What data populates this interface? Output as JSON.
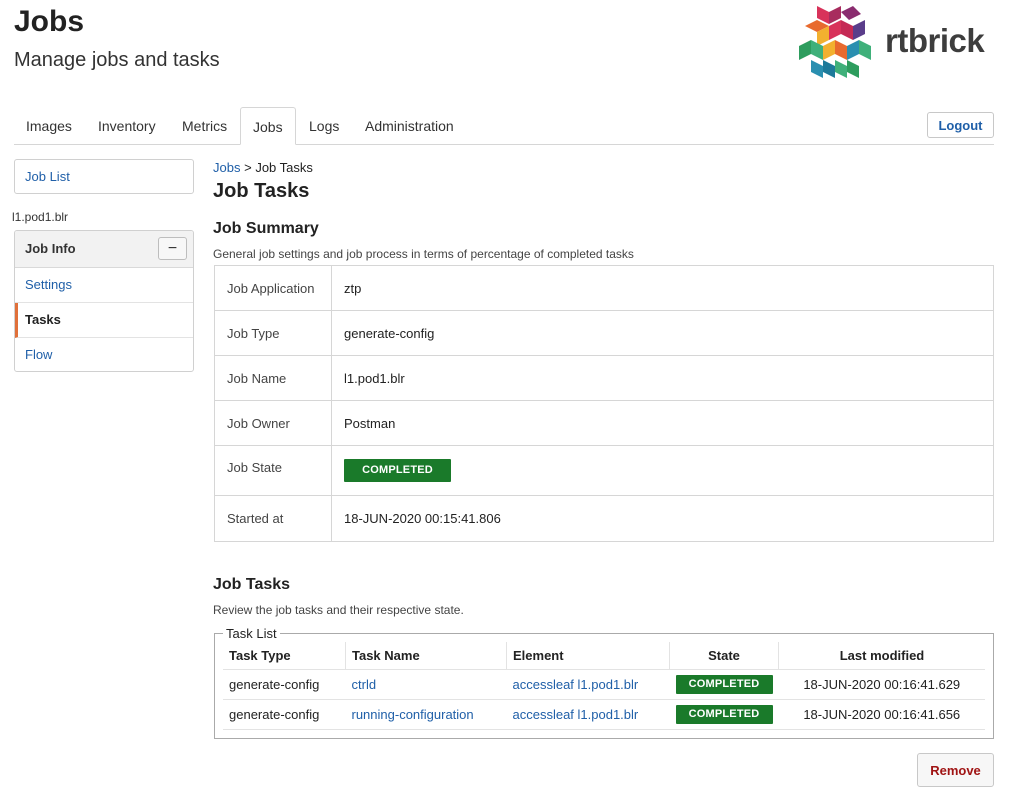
{
  "header": {
    "title": "Jobs",
    "subtitle": "Manage jobs and tasks",
    "logo_text": "rtbrick",
    "logo_colors": [
      "#d8325a",
      "#8a2c6f",
      "#f2b02f",
      "#3fb07a",
      "#2a8fb0",
      "#5a3d8a",
      "#e86a2e"
    ]
  },
  "nav": {
    "tabs": [
      {
        "label": "Images",
        "active": false
      },
      {
        "label": "Inventory",
        "active": false
      },
      {
        "label": "Metrics",
        "active": false
      },
      {
        "label": "Jobs",
        "active": true
      },
      {
        "label": "Logs",
        "active": false
      },
      {
        "label": "Administration",
        "active": false
      }
    ],
    "logout_label": "Logout"
  },
  "sidebar": {
    "job_list_label": "Job List",
    "job_name": "l1.pod1.blr",
    "panel_title": "Job Info",
    "collapse_symbol": "−",
    "items": [
      {
        "label": "Settings",
        "active": false
      },
      {
        "label": "Tasks",
        "active": true
      },
      {
        "label": "Flow",
        "active": false
      }
    ]
  },
  "main": {
    "breadcrumb": {
      "link": "Jobs",
      "separator": ">",
      "current": "Job Tasks"
    },
    "title": "Job Tasks",
    "summary": {
      "title": "Job Summary",
      "description": "General job settings and job process in terms of percentage of completed tasks",
      "rows": [
        {
          "key": "Job Application",
          "value": "ztp"
        },
        {
          "key": "Job Type",
          "value": "generate-config"
        },
        {
          "key": "Job Name",
          "value": "l1.pod1.blr"
        },
        {
          "key": "Job Owner",
          "value": "Postman"
        },
        {
          "key": "Job State",
          "value": "COMPLETED"
        },
        {
          "key": "Started at",
          "value": "18-JUN-2020 00:15:41.806"
        }
      ]
    },
    "tasks": {
      "title": "Job Tasks",
      "description": "Review the job tasks and their respective state.",
      "legend": "Task List",
      "columns": [
        "Task Type",
        "Task Name",
        "Element",
        "State",
        "Last modified"
      ],
      "rows": [
        {
          "type": "generate-config",
          "name": "ctrld",
          "element": "accessleaf l1.pod1.blr",
          "state": "COMPLETED",
          "modified": "18-JUN-2020 00:16:41.629"
        },
        {
          "type": "generate-config",
          "name": "running-configuration",
          "element": "accessleaf l1.pod1.blr",
          "state": "COMPLETED",
          "modified": "18-JUN-2020 00:16:41.656"
        }
      ]
    },
    "remove_label": "Remove"
  },
  "colors": {
    "link": "#1f5fa8",
    "status_completed": "#1a7a2a",
    "remove_text": "#a01414",
    "active_sidebar_accent": "#e0703a"
  }
}
